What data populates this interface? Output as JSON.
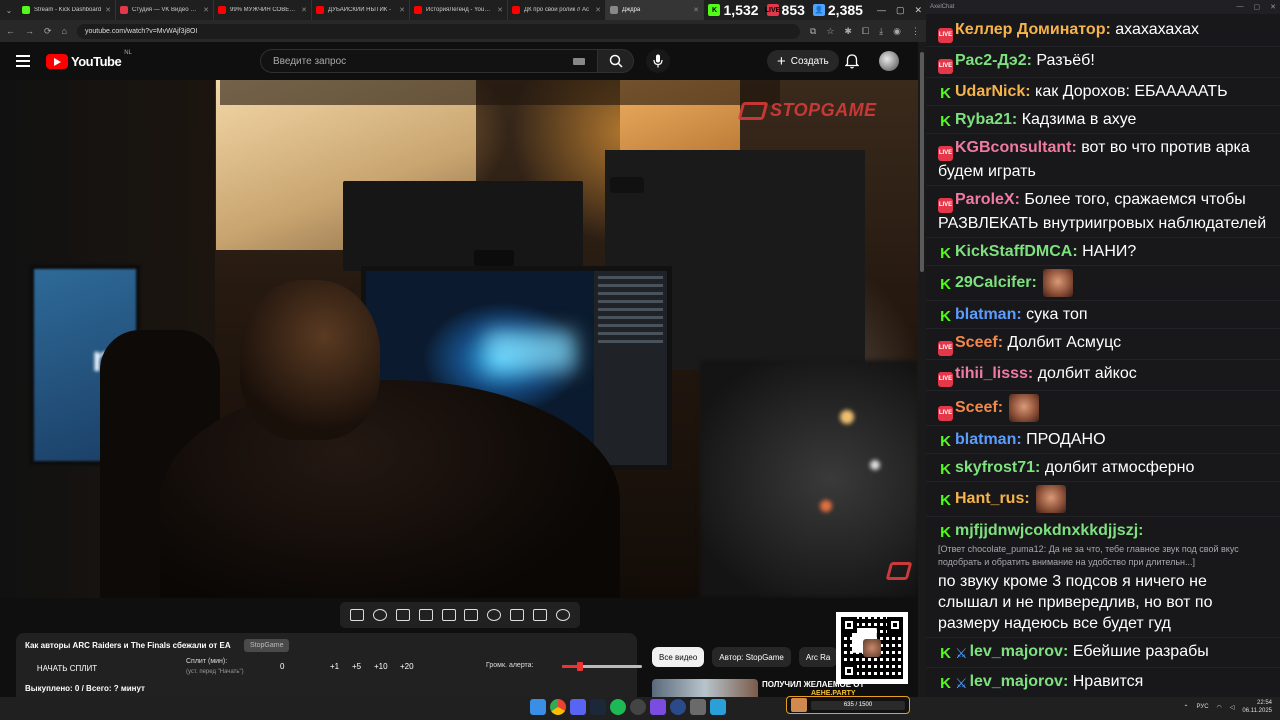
{
  "browser": {
    "tabs": [
      {
        "title": "Stream - Kick Dashboard",
        "color": "#53fc18"
      },
      {
        "title": "Студия — VK Видео Live",
        "color": "#e4374a"
      },
      {
        "title": "99% МУЖЧИН СОВЕРШ…",
        "color": "#ff0000"
      },
      {
        "title": "ДУБАЙСКИЙ НЫТИК -",
        "color": "#ff0000"
      },
      {
        "title": "ИсторияЛегенд - YouTube",
        "color": "#ff0000"
      },
      {
        "title": "ДК про свой ролик // Ас",
        "color": "#ff0000"
      },
      {
        "title": "Дждра",
        "color": "#888888",
        "active": true
      }
    ],
    "stats": [
      {
        "icon": "K",
        "value": "1,532",
        "color": "#53fc18"
      },
      {
        "icon": "LIVE",
        "value": "853",
        "color": "#e4374a"
      },
      {
        "icon": "👤",
        "value": "2,385",
        "color": "#4fa3ff"
      }
    ],
    "url": "youtube.com/watch?v=MvWAjf3j8OI"
  },
  "youtube": {
    "logo_text": "YouTube",
    "region": "NL",
    "search_placeholder": "Введите запрос",
    "create_label": "Создать",
    "video_overlay_logo": "STOPGAME",
    "chips": [
      {
        "label": "Все видео",
        "active": true
      },
      {
        "label": "Автор: StopGame",
        "active": false
      },
      {
        "label": "Arc Ra",
        "active": false
      }
    ],
    "recommendation_title": "ПОЛУЧИЛ ЖЕЛАЕМОЕ ОТ"
  },
  "split_panel": {
    "title": "Как авторы ARC Raiders и The Finals сбежали от EA",
    "badge": "StopGame",
    "start_button": "НАЧАТЬ СПЛИТ",
    "split_label": "Сплит (мин):",
    "split_hint": "(уст. перед \"Начать\")",
    "split_value": "0",
    "increments": [
      "+1",
      "+5",
      "+10",
      "+20"
    ],
    "alert_label": "Громк. алерта:",
    "alert_volume": 0.22,
    "footer": "Выкуплено: 0 / Всего: ? минут"
  },
  "chat": {
    "window_title": "AxelChat",
    "messages": [
      {
        "platform": "vk",
        "user": "Келлер Доминатор",
        "color": "#f6b34a",
        "text": "ахахахахах"
      },
      {
        "platform": "vk",
        "user": "Рас2-Дэ2",
        "color": "#7ee07e",
        "text": "Разъёб!"
      },
      {
        "platform": "kick",
        "user": "UdarNick",
        "color": "#f6b34a",
        "text": "как Дорохов: ЕБАААААТЬ"
      },
      {
        "platform": "kick",
        "user": "Ryba21",
        "color": "#7ee07e",
        "text": "Кадзима в ахуе"
      },
      {
        "platform": "vk",
        "user": "KGBconsultant",
        "color": "#f07ba0",
        "text": "вот во что против арка будем играть"
      },
      {
        "platform": "vk",
        "user": "ParoleX",
        "color": "#f07ba0",
        "text": "Более того, сражаемся чтобы РАЗВЛЕКАТЬ внутриигровых наблюдателей"
      },
      {
        "platform": "kick",
        "user": "KickStaffDMCA",
        "color": "#7ee07e",
        "text": "НАНИ?"
      },
      {
        "platform": "kick",
        "user": "29Calcifer",
        "color": "#7ee07e",
        "text": "",
        "emote": true
      },
      {
        "platform": "kick",
        "user": "blatman",
        "color": "#5b9dff",
        "text": "сука топ"
      },
      {
        "platform": "vk",
        "user": "Sceef",
        "color": "#f2884a",
        "text": "Долбит Асмуцс"
      },
      {
        "platform": "vk",
        "user": "tihii_lisss",
        "color": "#f07ba0",
        "text": "долбит айкос"
      },
      {
        "platform": "vk",
        "user": "Sceef",
        "color": "#f2884a",
        "text": "",
        "emote": true
      },
      {
        "platform": "kick",
        "user": "blatman",
        "color": "#5b9dff",
        "text": "ПРОДАНО"
      },
      {
        "platform": "kick",
        "user": "skyfrost71",
        "color": "#7ee07e",
        "text": "долбит атмосферно"
      },
      {
        "platform": "kick",
        "user": "Hant_rus",
        "color": "#f6b34a",
        "text": "",
        "emote": true
      },
      {
        "platform": "kick",
        "user": "mjfjjdnwjcokdnxkkdjjszj",
        "color": "#7ee07e",
        "reply": "[Ответ chocolate_puma12: Да не за что, тебе главное звук под свой вкус подобрать и обратить внимание на удобство при длительн...]",
        "text": "по звуку кроме 3 подсов я ничего не слышал и не привередлив, но вот по размеру надеюсь все будет гуд"
      },
      {
        "platform": "kick",
        "user": "lev_majorov",
        "color": "#7ee07e",
        "badge": true,
        "text": "Ебейшие разрабы"
      },
      {
        "platform": "kick",
        "user": "lev_majorov",
        "color": "#7ee07e",
        "badge": true,
        "text": "Нравится"
      }
    ]
  },
  "taskbar": {
    "widget_label": "AEHE.PARTY",
    "widget_progress": "635 / 1500",
    "lang": "РУС",
    "time": "22:54",
    "date": "06.11.2025"
  }
}
